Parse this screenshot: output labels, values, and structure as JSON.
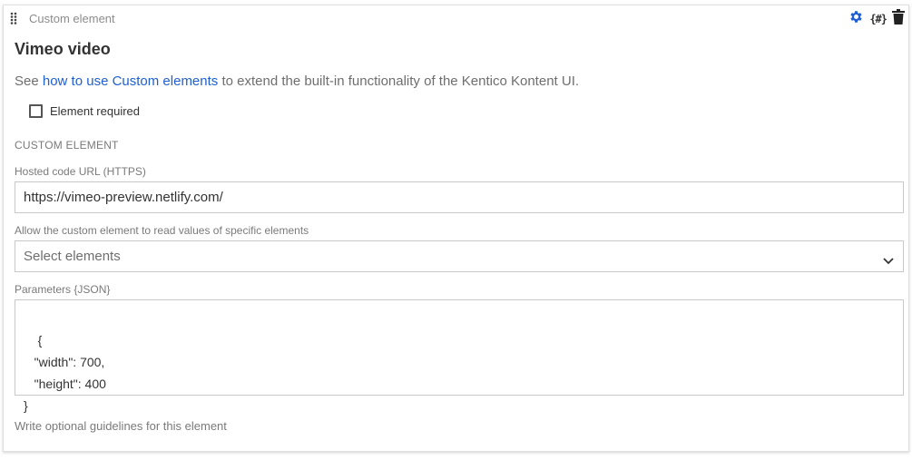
{
  "header": {
    "type_label": "Custom element",
    "actions": {
      "settings_icon": "gear-icon",
      "codename_icon": "{#}",
      "delete_icon": "trash-icon"
    }
  },
  "element": {
    "title": "Vimeo video",
    "description_prefix": "See ",
    "description_link": "how to use Custom elements",
    "description_suffix": " to extend the built-in functionality of the Kentico Kontent UI.",
    "required_label": "Element required",
    "required_checked": false
  },
  "custom_element": {
    "section_title": "CUSTOM ELEMENT",
    "hosted_url_label": "Hosted code URL (HTTPS)",
    "hosted_url_value": "https://vimeo-preview.netlify.com/",
    "allowed_elements_label": "Allow the custom element to read values of specific elements",
    "allowed_elements_placeholder": "Select elements",
    "parameters_label": "Parameters {JSON}",
    "parameters_value": "{\n   \"width\": 700,\n   \"height\": 400\n}"
  },
  "guidelines_placeholder": "Write optional guidelines for this element",
  "colors": {
    "accent": "#1f5fd1",
    "link": "#1f5fd1",
    "muted": "#7a7a7a"
  }
}
